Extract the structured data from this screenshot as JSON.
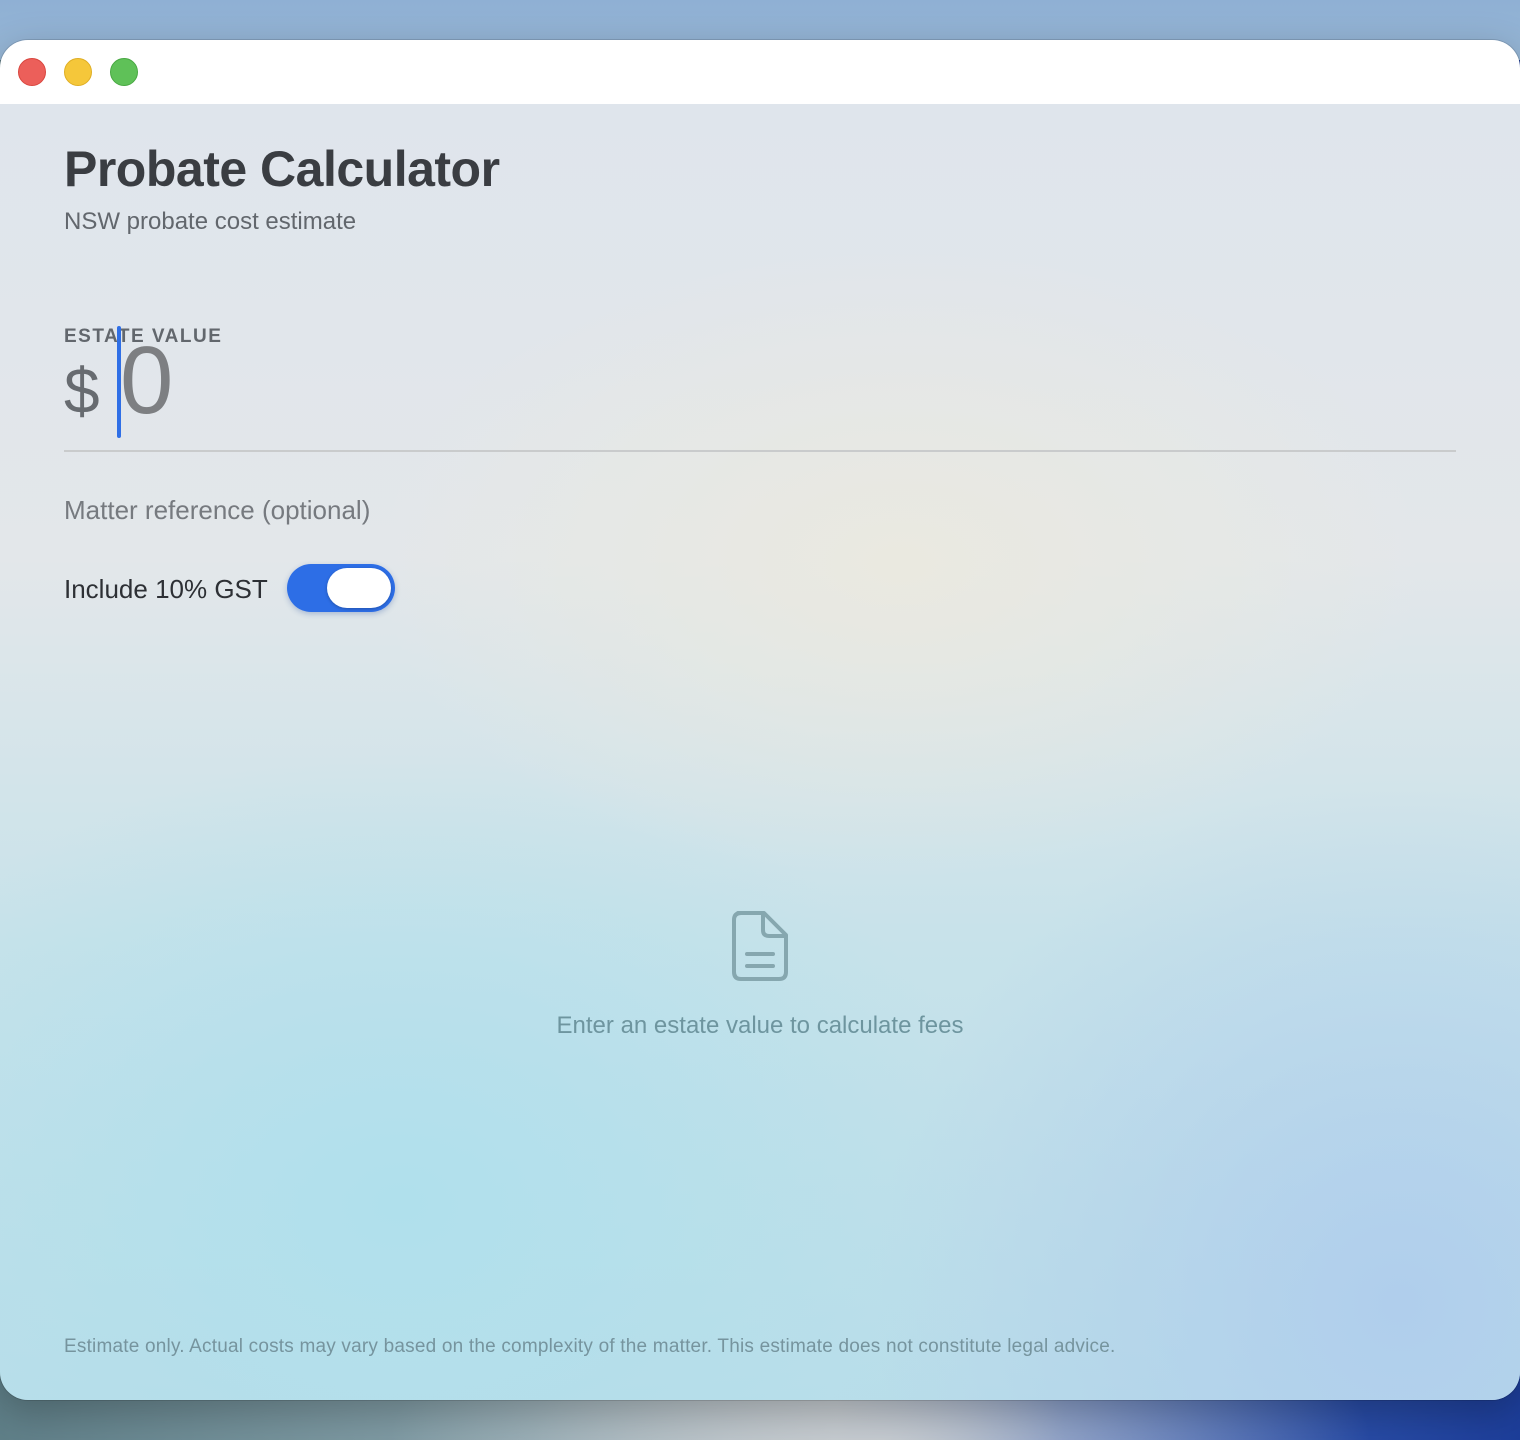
{
  "window": {
    "controls": {
      "close": "close-window",
      "minimize": "minimize-window",
      "maximize": "maximize-window"
    }
  },
  "header": {
    "title": "Probate Calculator",
    "subtitle": "NSW probate cost estimate"
  },
  "estate": {
    "label": "ESTATE VALUE",
    "currency_symbol": "$",
    "value": "",
    "placeholder": "0"
  },
  "matter": {
    "value": "",
    "placeholder": "Matter reference (optional)"
  },
  "gst": {
    "label": "Include 10% GST",
    "enabled": true,
    "accent_color": "#2d6ee6"
  },
  "empty_state": {
    "icon": "document-icon",
    "message": "Enter an estate value to calculate fees"
  },
  "footer": {
    "disclaimer": "Estimate only. Actual costs may vary based on the complexity of the matter. This estimate does not constitute legal advice."
  }
}
